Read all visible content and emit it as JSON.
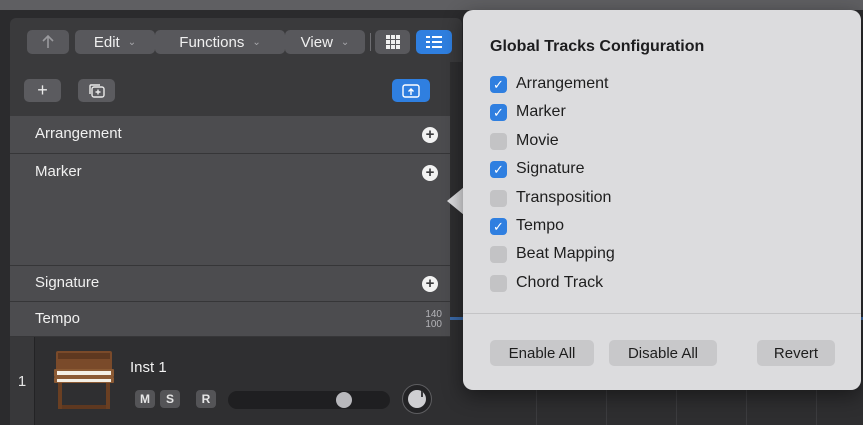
{
  "toolbar": {
    "up_icon": "up-arrow-icon",
    "edit_label": "Edit",
    "functions_label": "Functions",
    "view_label": "View",
    "chevron": "⌄",
    "grid_icon": "grid-view-icon",
    "list_icon": "list-view-icon",
    "accent_color": "#2f7fe0"
  },
  "track_header": {
    "add_label": "+",
    "add_icon": "plus-icon",
    "duplicate_icon": "duplicate-track-icon",
    "global_tracks_icon": "global-tracks-icon",
    "global_tracks": [
      {
        "name": "Arrangement",
        "plus": "+"
      },
      {
        "name": "Marker",
        "plus": "+"
      },
      {
        "name": "Signature",
        "plus": "+"
      },
      {
        "name": "Tempo",
        "range_top": "140",
        "range_bottom": "100"
      }
    ],
    "instrument": {
      "number": "1",
      "name": "Inst 1",
      "mute": "M",
      "solo": "S",
      "record": "R",
      "volume_level": 0.74,
      "icon": "organ-icon"
    }
  },
  "popover": {
    "title": "Global Tracks Configuration",
    "options": [
      {
        "label": "Arrangement",
        "checked": true
      },
      {
        "label": "Marker",
        "checked": true
      },
      {
        "label": "Movie",
        "checked": false
      },
      {
        "label": "Signature",
        "checked": true
      },
      {
        "label": "Transposition",
        "checked": false
      },
      {
        "label": "Tempo",
        "checked": true
      },
      {
        "label": "Beat Mapping",
        "checked": false
      },
      {
        "label": "Chord Track",
        "checked": false
      }
    ],
    "enable_all": "Enable All",
    "disable_all": "Disable All",
    "revert": "Revert"
  }
}
